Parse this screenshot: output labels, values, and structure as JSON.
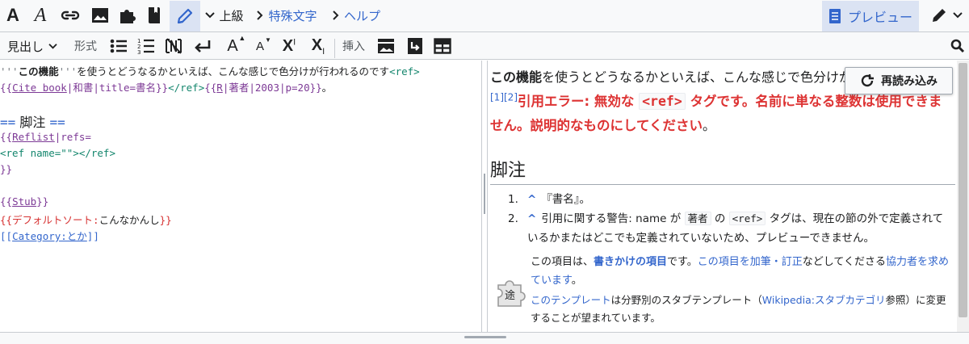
{
  "toolbar": {
    "bold_label": "A",
    "italic_label": "A",
    "advanced_label": "上級",
    "special_chars_label": "特殊文字",
    "help_label": "ヘルプ",
    "preview_label": "プレビュー"
  },
  "toolbar2": {
    "heading_label": "見出し",
    "format_label": "形式",
    "insert_label": "挿入",
    "superscript_label": "X",
    "superscript_mark": "I",
    "subscript_label": "X",
    "subscript_mark": "I",
    "big_label": "A",
    "small_label": "A"
  },
  "editor": {
    "line1_mk1": "'''",
    "line1_bold": "この機能",
    "line1_mk2": "'''",
    "line1_text": "を使うとどうなるかといえば、こんな感じで色分けが行われるのです",
    "line1_ref": "<ref>",
    "line2_open": "{{",
    "line2_name": "Cite book",
    "line2_rest": "|和書|title=書名}}",
    "line2_close_ref": "</ref>",
    "line2_tpl_open": "{{",
    "line2_tpl_r": "R",
    "line2_tpl_rest": "|著者|2003|p=20}}",
    "line2_end": "。",
    "heading_mk1": "==",
    "heading_text": " 脚注 ",
    "heading_mk2": "==",
    "reflist_open": "{{",
    "reflist_name": "Reflist",
    "reflist_rest": "|refs=",
    "ref_line": "<ref name=\"\"></ref>",
    "close_braces": "}}",
    "stub_open": "{{",
    "stub_name": "Stub",
    "stub_close": "}}",
    "defsort_open": "{{デフォルトソート:",
    "defsort_value": "こんなかんし",
    "defsort_close": "}}",
    "cat_open": "[[",
    "cat_name": "Category:とか",
    "cat_close": "]]"
  },
  "preview": {
    "reload_label": "再読み込み",
    "para_bold": "この機能",
    "para_text": "を使うとどうなるかといえば、こんな感じで色分けが行われるのです",
    "sup1": "[1]",
    "sup2": "[2]",
    "error_prefix": "引用エラー: 無効な ",
    "error_code": "<ref>",
    "error_suffix": " タグです。名前に単なる整数は使用できません。説明的なものにしてください",
    "error_end": "。",
    "heading": "脚注",
    "refs": [
      {
        "num": "1.",
        "caret": "^",
        "text": "『書名』。"
      },
      {
        "num": "2.",
        "caret": "^",
        "pre": "引用に関する警告: name が ",
        "code1": "著者",
        "mid": " の ",
        "code2": "<ref>",
        "post": " タグは、現在の節の外で定義されているかまたはどこでも定義されていないため、プレビューできません。"
      }
    ],
    "stub": {
      "t1": "この項目は、",
      "link1": "書きかけの項目",
      "t2": "です。",
      "link2": "この項目を加筆・訂正",
      "t3": "などしてくださる",
      "link3": "協力者を求めています",
      "t4": "。",
      "note_link1": "このテンプレート",
      "note_t1": "は分野別のスタブテンプレート（",
      "note_link2": "Wikipedia:スタブカテゴリ",
      "note_t2": "参照）に変更することが望まれています。",
      "icon_label": "途"
    }
  },
  "colors": {
    "link": "#3366cc",
    "error": "#dd3333",
    "template": "#7d3a96",
    "tag": "#14866d"
  }
}
